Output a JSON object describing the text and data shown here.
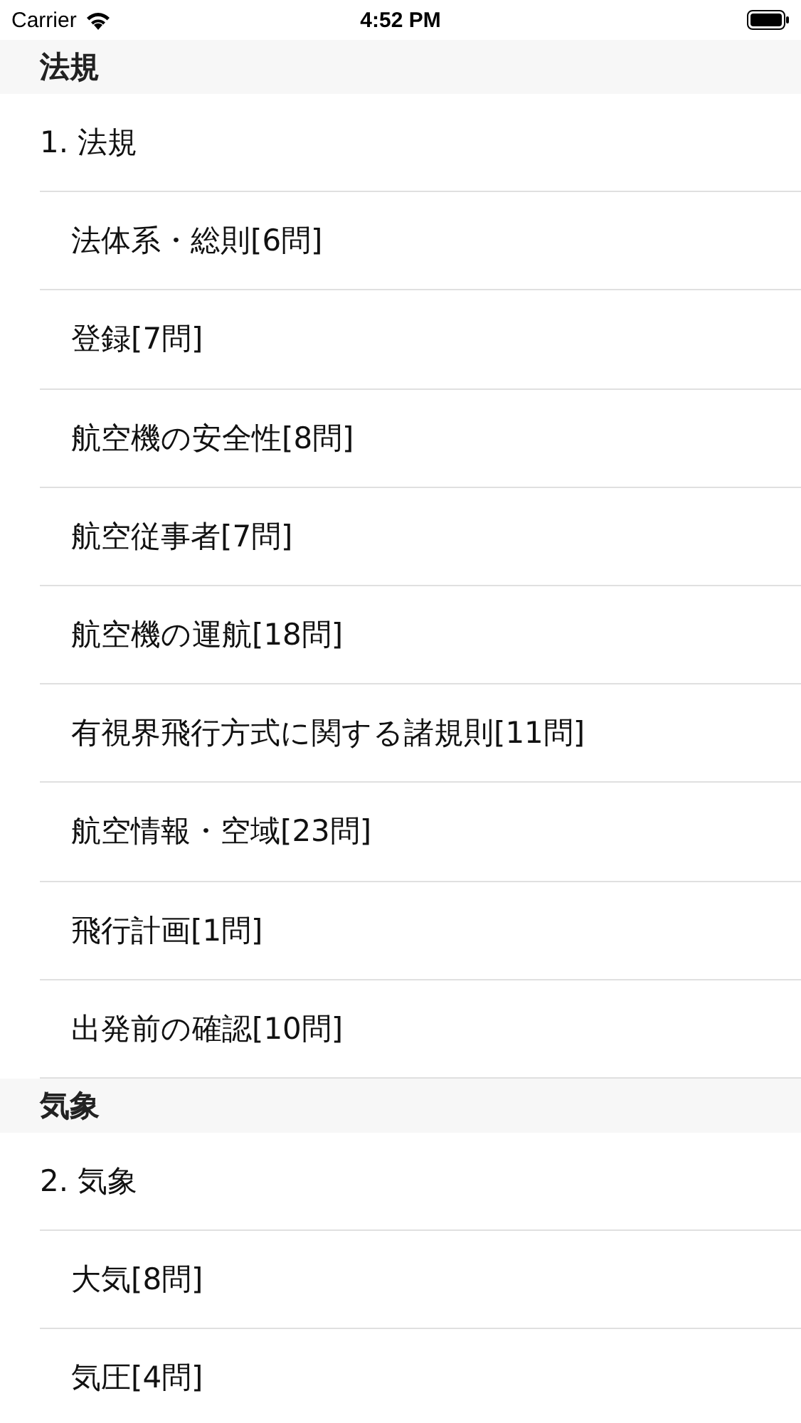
{
  "status_bar": {
    "carrier": "Carrier",
    "time": "4:52 PM"
  },
  "sections": [
    {
      "header": "法規",
      "items": [
        {
          "label": "1. 法規",
          "children": [
            {
              "label": "法体系・総則[6問]"
            },
            {
              "label": "登録[7問]"
            },
            {
              "label": "航空機の安全性[8問]"
            },
            {
              "label": "航空従事者[7問]"
            },
            {
              "label": "航空機の運航[18問]"
            },
            {
              "label": "有視界飛行方式に関する諸規則[11問]"
            },
            {
              "label": "航空情報・空域[23問]"
            },
            {
              "label": "飛行計画[1問]"
            },
            {
              "label": "出発前の確認[10問]"
            }
          ]
        }
      ]
    },
    {
      "header": "気象",
      "items": [
        {
          "label": "2. 気象",
          "children": [
            {
              "label": "大気[8問]"
            },
            {
              "label": "気圧[4問]"
            }
          ]
        }
      ]
    }
  ]
}
